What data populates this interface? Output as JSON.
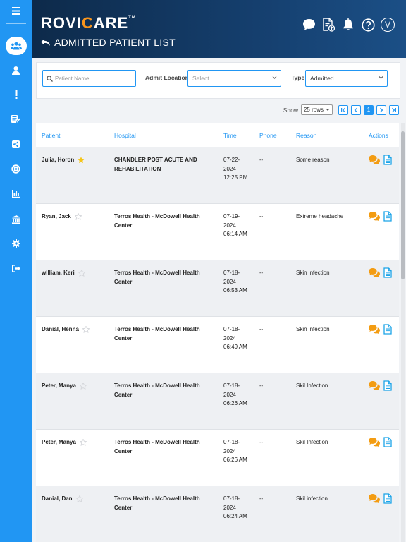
{
  "app": {
    "logo_prefix": "RO",
    "logo_v": "V",
    "logo_i": "I",
    "logo_c": "C",
    "logo_suffix": "ARE",
    "trademark": "TM",
    "page_title": "ADMITTED PATIENT LIST",
    "user_initial": "V"
  },
  "sidebar": {
    "items": [
      {
        "icon": "users-icon",
        "active": true
      },
      {
        "icon": "user-icon",
        "active": false
      },
      {
        "icon": "exclamation-icon",
        "active": false
      },
      {
        "icon": "edit-list-icon",
        "active": false
      },
      {
        "icon": "share-icon",
        "active": false
      },
      {
        "icon": "lifebuoy-icon",
        "active": false
      },
      {
        "icon": "bar-chart-icon",
        "active": false
      },
      {
        "icon": "bank-icon",
        "active": false
      },
      {
        "icon": "gear-icon",
        "active": false
      },
      {
        "icon": "sign-out-icon",
        "active": false
      }
    ]
  },
  "filters": {
    "search_placeholder": "Patient Name",
    "admit_location_label": "Admit Location",
    "admit_location_value": "Select",
    "type_label": "Type",
    "type_value": "Admitted"
  },
  "pagination": {
    "show_label": "Show",
    "rows_value": "25 rows",
    "current_page": "1"
  },
  "table": {
    "headers": {
      "patient": "Patient",
      "hospital": "Hospital",
      "time": "Time",
      "phone": "Phone",
      "reason": "Reason",
      "actions": "Actions"
    },
    "rows": [
      {
        "patient": "Julia, Horon",
        "starred": true,
        "hospital": "CHANDLER POST ACUTE AND REHABILITATION",
        "time": "07-22-2024 12:25 PM",
        "phone": "--",
        "reason": "Some reason"
      },
      {
        "patient": "Ryan, Jack",
        "starred": false,
        "hospital": "Terros Health - McDowell Health Center",
        "time": "07-19-2024 06:14 AM",
        "phone": "--",
        "reason": "Extreme headache"
      },
      {
        "patient": "william, Keri",
        "starred": false,
        "hospital": "Terros Health - McDowell Health Center",
        "time": "07-18-2024 06:53 AM",
        "phone": "--",
        "reason": "Skin infection"
      },
      {
        "patient": "Danial, Henna",
        "starred": false,
        "hospital": "Terros Health - McDowell Health Center",
        "time": "07-18-2024 06:49 AM",
        "phone": "--",
        "reason": "Skin infection"
      },
      {
        "patient": "Peter, Manya",
        "starred": false,
        "hospital": "Terros Health - McDowell Health Center",
        "time": "07-18-2024 06:26 AM",
        "phone": "--",
        "reason": "Skil Infection"
      },
      {
        "patient": "Peter, Manya",
        "starred": false,
        "hospital": "Terros Health - McDowell Health Center",
        "time": "07-18-2024 06:26 AM",
        "phone": "--",
        "reason": "Skil Infection"
      },
      {
        "patient": "Danial, Dan",
        "starred": false,
        "hospital": "Terros Health - McDowell Health Center",
        "time": "07-18-2024 06:24 AM",
        "phone": "--",
        "reason": "Skil infection"
      }
    ]
  },
  "colors": {
    "sidebar": "#2196f3",
    "accent": "#2196f3",
    "brand_orange": "#f7941d",
    "star_active": "#f5c518",
    "chat_icon": "#f39c12",
    "doc_icon": "#1aa3e8"
  }
}
